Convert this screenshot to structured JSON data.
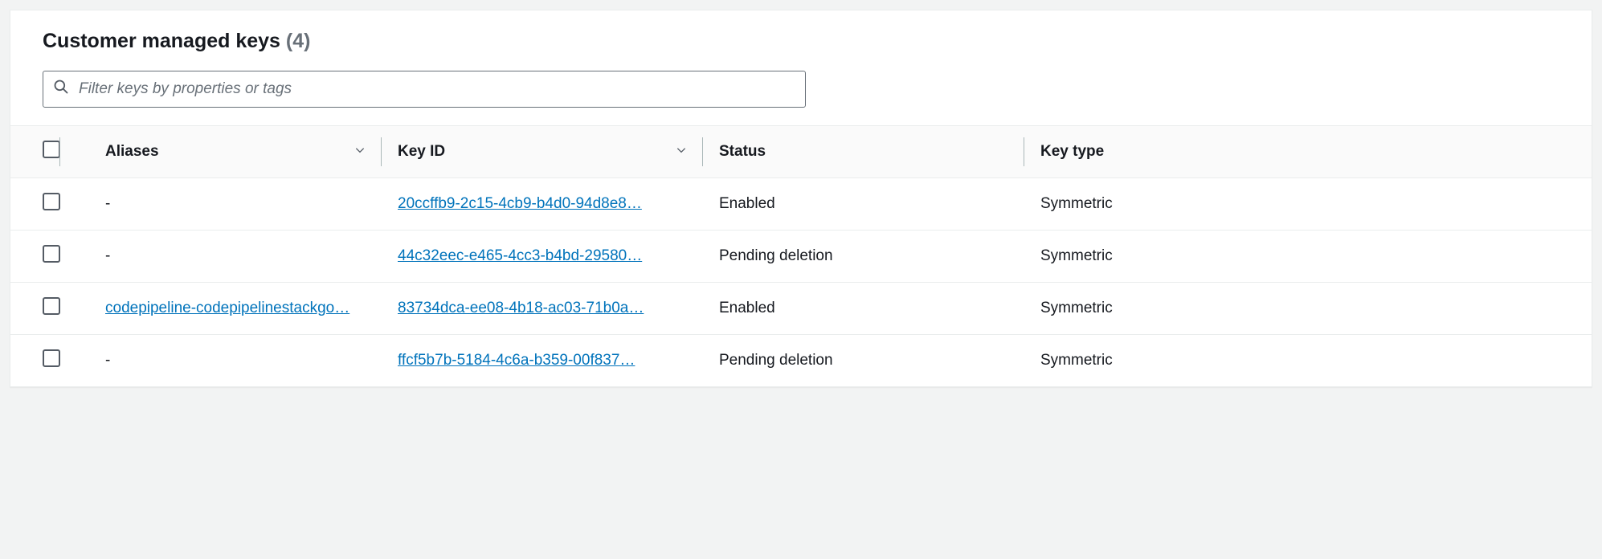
{
  "title_text": "Customer managed keys",
  "count_text": "(4)",
  "filter": {
    "placeholder": "Filter keys by properties or tags"
  },
  "columns": {
    "aliases": "Aliases",
    "key_id": "Key ID",
    "status": "Status",
    "key_type": "Key type"
  },
  "rows": [
    {
      "alias": "-",
      "alias_is_link": false,
      "key_id": "20ccffb9-2c15-4cb9-b4d0-94d8e8…",
      "status": "Enabled",
      "key_type": "Symmetric"
    },
    {
      "alias": "-",
      "alias_is_link": false,
      "key_id": "44c32eec-e465-4cc3-b4bd-29580…",
      "status": "Pending deletion",
      "key_type": "Symmetric"
    },
    {
      "alias": "codepipeline-codepipelinestackgo…",
      "alias_is_link": true,
      "key_id": "83734dca-ee08-4b18-ac03-71b0a…",
      "status": "Enabled",
      "key_type": "Symmetric"
    },
    {
      "alias": "-",
      "alias_is_link": false,
      "key_id": "ffcf5b7b-5184-4c6a-b359-00f837…",
      "status": "Pending deletion",
      "key_type": "Symmetric"
    }
  ]
}
